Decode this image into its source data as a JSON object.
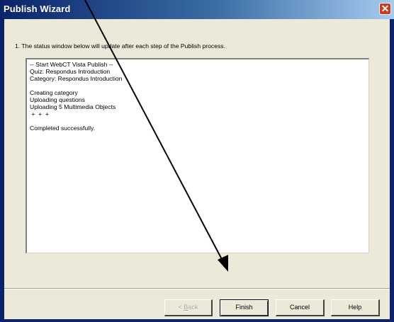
{
  "window": {
    "title": "Publish Wizard",
    "close_glyph": "✕"
  },
  "instruction": "1.  The status window below will update after each step of the Publish process.",
  "status_lines": [
    "-- Start WebCT Vista Publish --",
    "Quiz: Respondus Introduction",
    "Category: Respondus Introduction",
    "",
    "Creating category",
    "Uploading questions",
    "Uploading 5 Multimedia Objects",
    " +  +  +",
    "",
    "Completed successfully."
  ],
  "buttons": {
    "back": {
      "prefix": "< ",
      "accel": "B",
      "rest": "ack",
      "enabled": false
    },
    "finish": "Finish",
    "cancel": "Cancel",
    "help": "Help"
  },
  "annotation": {
    "type": "arrow",
    "color": "#000000",
    "points_to": "finish-button"
  }
}
